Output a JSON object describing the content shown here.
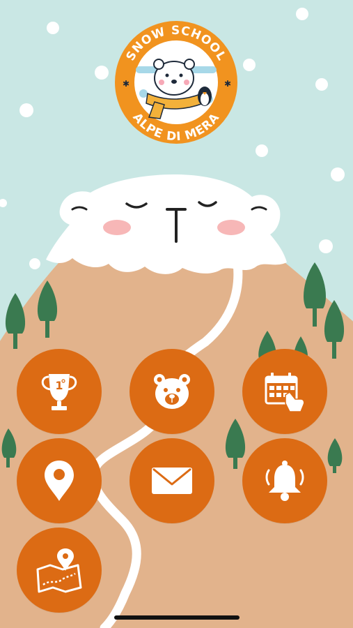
{
  "app": {
    "logo": {
      "top_text": "SNOW SCHOOL",
      "bottom_text": "ALPE DI MERA"
    }
  },
  "menu": {
    "buttons": [
      {
        "name": "results-button",
        "icon": "trophy-icon"
      },
      {
        "name": "kids-area-button",
        "icon": "bear-icon"
      },
      {
        "name": "booking-button",
        "icon": "calendar-booking-icon"
      },
      {
        "name": "location-button",
        "icon": "map-pin-icon"
      },
      {
        "name": "contact-button",
        "icon": "mail-icon"
      },
      {
        "name": "notifications-button",
        "icon": "bell-icon"
      },
      {
        "name": "trail-map-button",
        "icon": "trail-map-icon"
      }
    ]
  },
  "colors": {
    "sky": "#c9e7e4",
    "mountain": "#e2b38c",
    "snow": "#ffffff",
    "button": "#dc6b14",
    "tree": "#3a7a50",
    "logo_orange": "#f1931f"
  }
}
